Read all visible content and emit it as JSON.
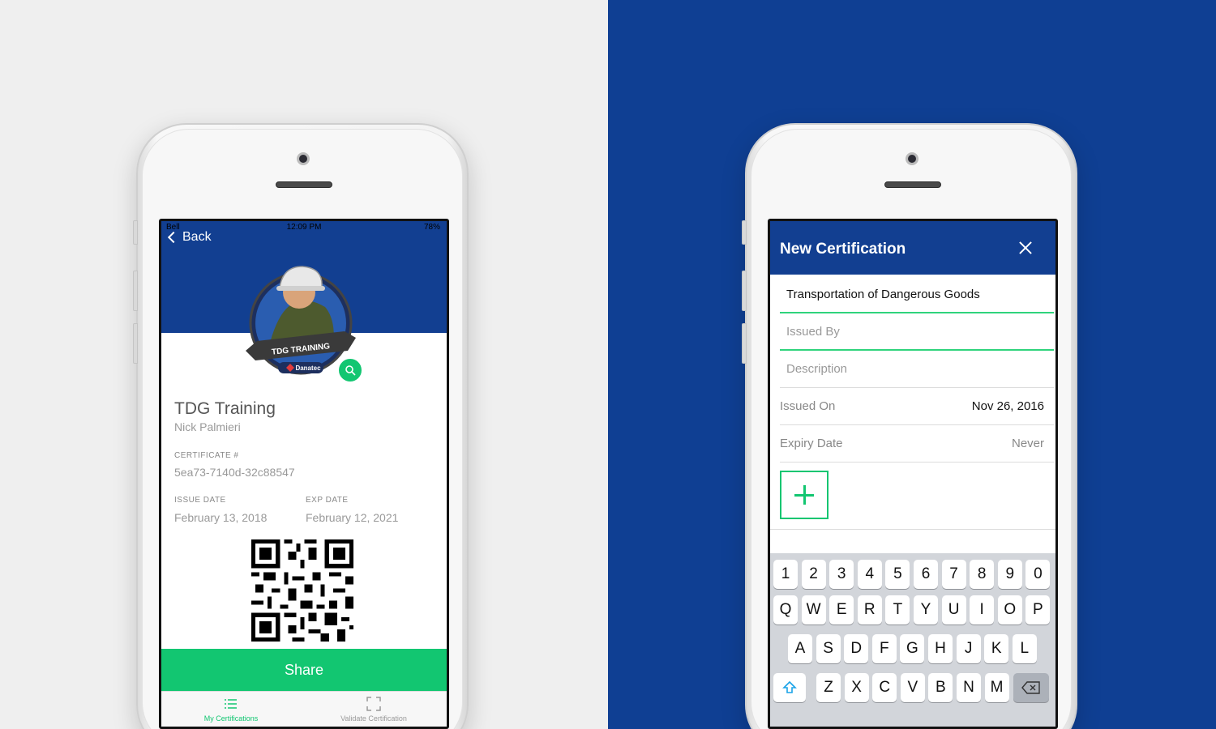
{
  "left_phone": {
    "status": {
      "carrier": "Bell",
      "time": "12:09 PM",
      "battery": "78%"
    },
    "back_label": "Back",
    "badge": {
      "ribbon_text": "TDG TRAINING",
      "brand": "Danatec"
    },
    "certificate": {
      "title": "TDG Training",
      "holder": "Nick Palmieri",
      "cert_label": "CERTIFICATE #",
      "cert_number": "5ea73-7140d-32c88547",
      "issue_label": "ISSUE DATE",
      "issue_date": "February 13, 2018",
      "exp_label": "EXP DATE",
      "exp_date": "February 12, 2021"
    },
    "share_label": "Share",
    "tabs": [
      {
        "label": "My Certifications",
        "icon": "list-icon",
        "color": "#12c671"
      },
      {
        "label": "Validate Certification",
        "icon": "scan-icon",
        "color": "#999999"
      }
    ]
  },
  "right_phone": {
    "title": "New Certification",
    "fields": {
      "name_value": "Transportation of Dangerous Goods",
      "issued_by_placeholder": "Issued By",
      "description_placeholder": "Description"
    },
    "rows": [
      {
        "label": "Issued On",
        "value": "Nov 26, 2016"
      },
      {
        "label": "Expiry Date",
        "value": "Never"
      }
    ],
    "keyboard": {
      "row1": [
        "1",
        "2",
        "3",
        "4",
        "5",
        "6",
        "7",
        "8",
        "9",
        "0"
      ],
      "row2": [
        "Q",
        "W",
        "E",
        "R",
        "T",
        "Y",
        "U",
        "I",
        "O",
        "P"
      ],
      "row3": [
        "A",
        "S",
        "D",
        "F",
        "G",
        "H",
        "J",
        "K",
        "L"
      ],
      "row4": [
        "Z",
        "X",
        "C",
        "V",
        "B",
        "N",
        "M"
      ]
    }
  },
  "colors": {
    "brand_blue": "#123f91",
    "accent_green": "#12c671",
    "left_bg": "#efefef",
    "right_bg": "#0f3f93"
  }
}
